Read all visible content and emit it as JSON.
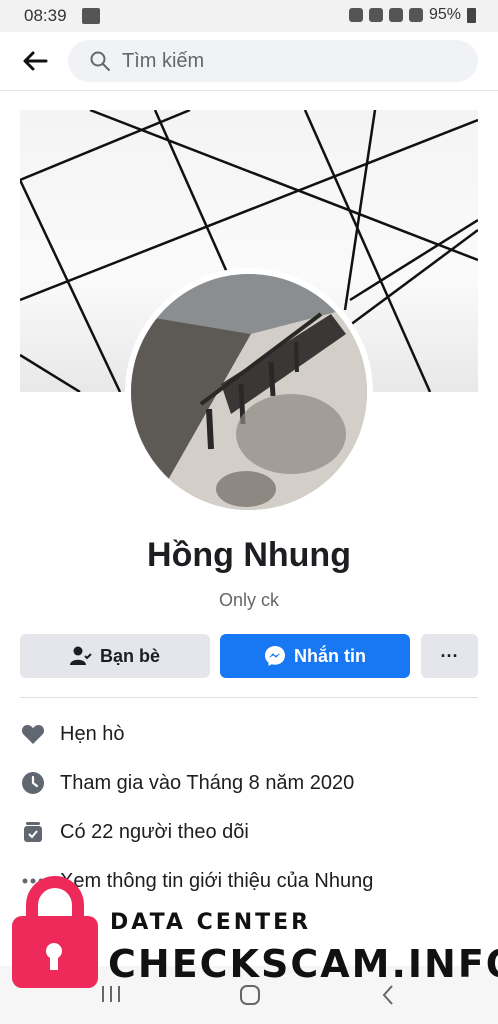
{
  "status_bar": {
    "time": "08:39",
    "battery": "95%"
  },
  "search": {
    "placeholder": "Tìm kiếm"
  },
  "profile": {
    "name": "Hồng Nhung",
    "bio": "Only ck"
  },
  "actions": {
    "friends_label": "Bạn bè",
    "message_label": "Nhắn tin",
    "more_label": "···"
  },
  "info": [
    {
      "icon": "heart-icon",
      "text": "Hẹn hò"
    },
    {
      "icon": "clock-icon",
      "text": "Tham gia vào Tháng 8 năm 2020"
    },
    {
      "icon": "followers-icon",
      "text": "Có 22 người theo dõi"
    },
    {
      "icon": "more-dots-icon",
      "text": "Xem thông tin giới thiệu của Nhung"
    }
  ],
  "watermark": {
    "top": "DATA CENTER",
    "main": "CHECKSCAM.INFO"
  },
  "colors": {
    "accent": "#1877f2",
    "watermark_lock": "#ee2a5a"
  }
}
